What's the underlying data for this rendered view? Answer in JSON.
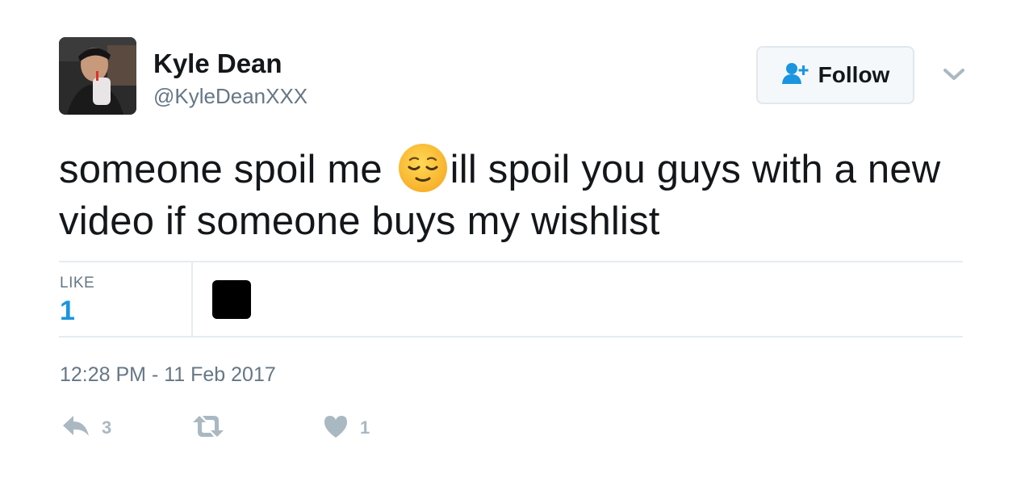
{
  "user": {
    "display_name": "Kyle Dean",
    "handle": "@KyleDeanXXX"
  },
  "follow_button": {
    "label": "Follow"
  },
  "tweet": {
    "text_before_emoji": "someone spoil me ",
    "emoji": "relieved-face-emoji",
    "text_after_emoji": "ill spoil you guys with a new video if someone buys my wishlist"
  },
  "stats": {
    "like_label": "LIKE",
    "like_count": "1"
  },
  "timestamp": "12:28 PM - 11 Feb 2017",
  "actions": {
    "reply_count": "3",
    "retweet_count": "",
    "like_count": "1"
  },
  "colors": {
    "link_blue": "#1b95e0",
    "muted_gray": "#657786",
    "action_gray": "#aab8c2",
    "divider": "#e6ecf0"
  },
  "icons": {
    "follow": "add-user-icon",
    "menu": "chevron-down-icon",
    "reply": "reply-icon",
    "retweet": "retweet-icon",
    "like": "heart-icon"
  }
}
